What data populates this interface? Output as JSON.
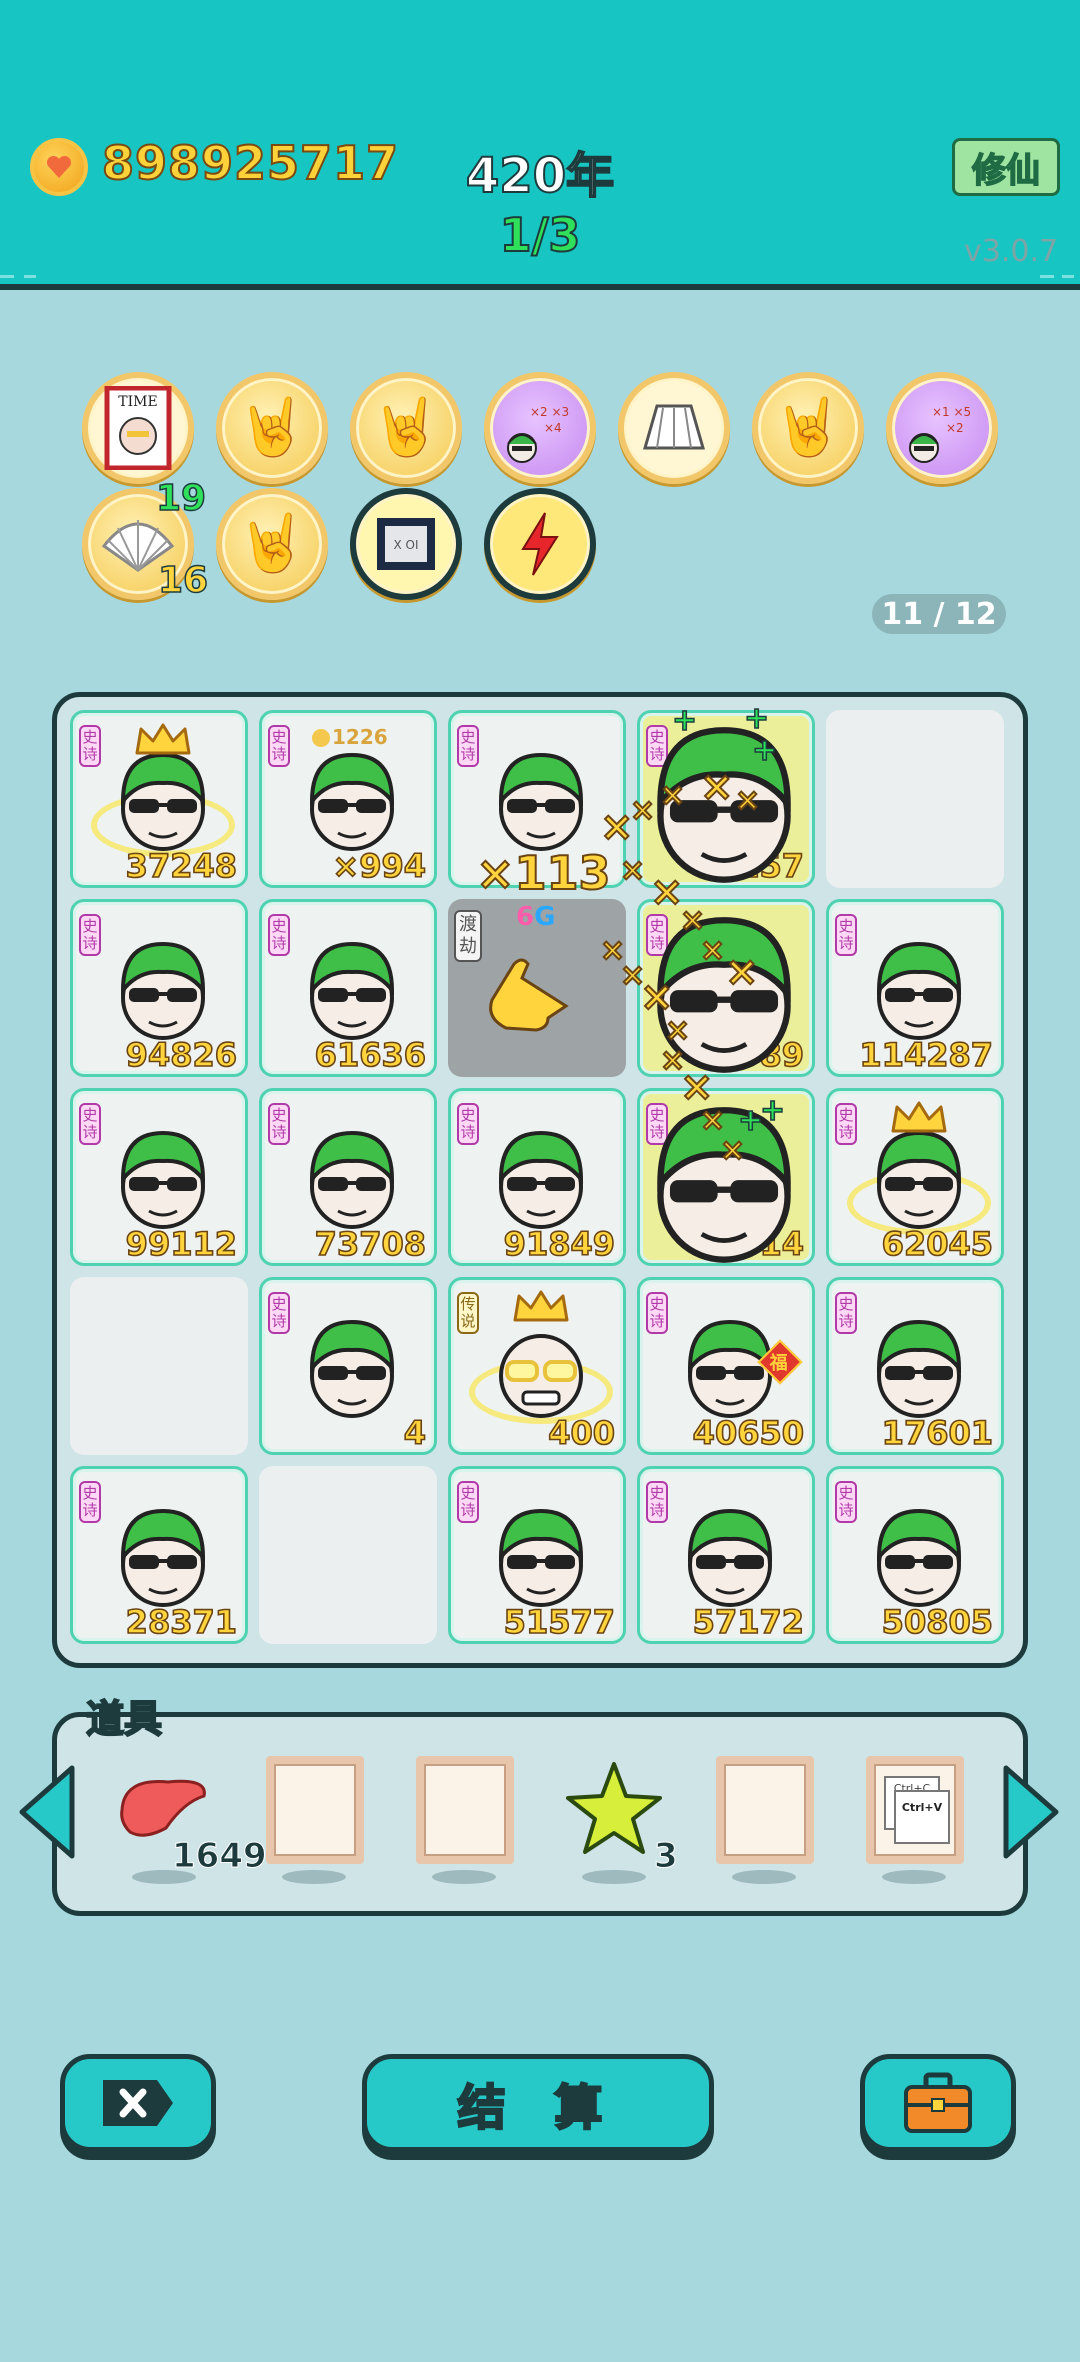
{
  "header": {
    "coins": "898925717",
    "year": "420年",
    "round": "1/3",
    "cultivate_button": "修仙",
    "version": "v3.0.7"
  },
  "relics": {
    "row1": [
      "time-magazine-icon",
      "rock-hand-icon",
      "rock-hand-icon",
      "multiplier-head-icon",
      "skirt-icon",
      "rock-hand-icon",
      "multiplier-head-icon"
    ],
    "row2": [
      "shell-icon",
      "rock-hand-icon",
      "cpu-chip-icon",
      "lightning-icon"
    ],
    "shell_count_top": "19",
    "shell_count_bottom": "16",
    "cpu_label": "X OI",
    "page_indicator": "11 / 12"
  },
  "board": {
    "badge_epic": "史诗",
    "badge_legend": "传说",
    "tiles": [
      {
        "v": "37248",
        "crown": true
      },
      {
        "v": "×994",
        "coin": "1226"
      },
      {
        "v": ""
      },
      {
        "v": "157",
        "hl": true
      },
      {
        "v": "",
        "empty": true
      },
      {
        "v": "94826"
      },
      {
        "v": "61636"
      },
      {
        "v": "",
        "dim": true
      },
      {
        "v": "589",
        "hl": true
      },
      {
        "v": "114287"
      },
      {
        "v": "99112"
      },
      {
        "v": "73708"
      },
      {
        "v": "91849"
      },
      {
        "v": "514",
        "hl": true
      },
      {
        "v": "62045",
        "crown": true
      },
      {
        "v": "",
        "empty": true
      },
      {
        "v": "4"
      },
      {
        "v": "400",
        "legend": true
      },
      {
        "v": "40650",
        "fu": true
      },
      {
        "v": "17601"
      },
      {
        "v": "28371"
      },
      {
        "v": "",
        "empty": true
      },
      {
        "v": "51577"
      },
      {
        "v": "57172"
      },
      {
        "v": "50805"
      }
    ],
    "combo": "×113",
    "tribulation_label": "渡劫",
    "tribulation_sub_num": "6",
    "tribulation_sub_unit": "G",
    "fu_char": "福"
  },
  "items": {
    "title": "道具",
    "liver_count": "1649",
    "star_count": "3",
    "copy_label_top": "Ctrl+C",
    "copy_label_bottom": "Ctrl+V"
  },
  "buttons": {
    "settle": "结 算"
  },
  "colors": {
    "header": "#17c5c3",
    "background": "#a6d8de",
    "number_gold": "#ffd43d",
    "round_green": "#2fe05a"
  }
}
